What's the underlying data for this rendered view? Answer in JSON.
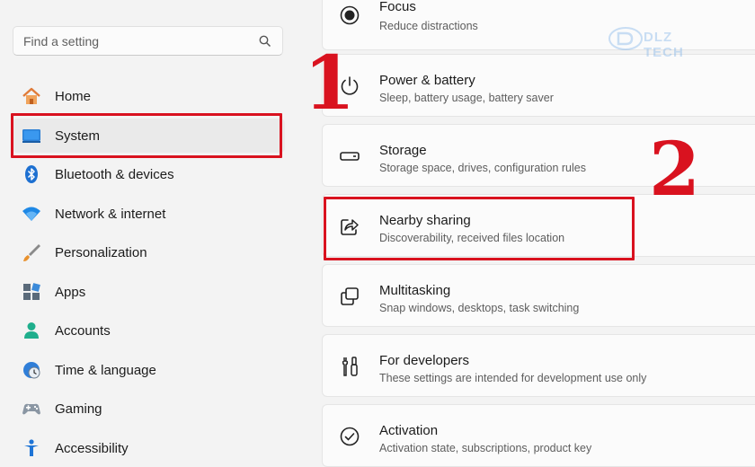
{
  "search": {
    "placeholder": "Find a setting"
  },
  "nav": {
    "items": [
      {
        "label": "Home",
        "icon": "home-icon"
      },
      {
        "label": "System",
        "icon": "system-icon",
        "selected": true
      },
      {
        "label": "Bluetooth & devices",
        "icon": "bluetooth-icon"
      },
      {
        "label": "Network & internet",
        "icon": "wifi-icon"
      },
      {
        "label": "Personalization",
        "icon": "brush-icon"
      },
      {
        "label": "Apps",
        "icon": "apps-icon"
      },
      {
        "label": "Accounts",
        "icon": "person-icon"
      },
      {
        "label": "Time & language",
        "icon": "clock-globe-icon"
      },
      {
        "label": "Gaming",
        "icon": "gamepad-icon"
      },
      {
        "label": "Accessibility",
        "icon": "accessibility-icon"
      }
    ]
  },
  "cards": [
    {
      "title": "Focus",
      "subtitle": "Reduce distractions",
      "icon": "focus-icon"
    },
    {
      "title": "Power & battery",
      "subtitle": "Sleep, battery usage, battery saver",
      "icon": "power-icon"
    },
    {
      "title": "Storage",
      "subtitle": "Storage space, drives, configuration rules",
      "icon": "storage-icon"
    },
    {
      "title": "Nearby sharing",
      "subtitle": "Discoverability, received files location",
      "icon": "share-icon"
    },
    {
      "title": "Multitasking",
      "subtitle": "Snap windows, desktops, task switching",
      "icon": "multitasking-icon"
    },
    {
      "title": "For developers",
      "subtitle": "These settings are intended for development use only",
      "icon": "developer-tools-icon"
    },
    {
      "title": "Activation",
      "subtitle": "Activation state, subscriptions, product key",
      "icon": "activation-icon"
    }
  ],
  "annotations": {
    "step1": "1",
    "step2": "2",
    "color": "#d9121f"
  },
  "watermark": {
    "text": "DLZ TECH"
  },
  "colors": {
    "accent": "#0067c0",
    "highlight": "#d9121f"
  }
}
